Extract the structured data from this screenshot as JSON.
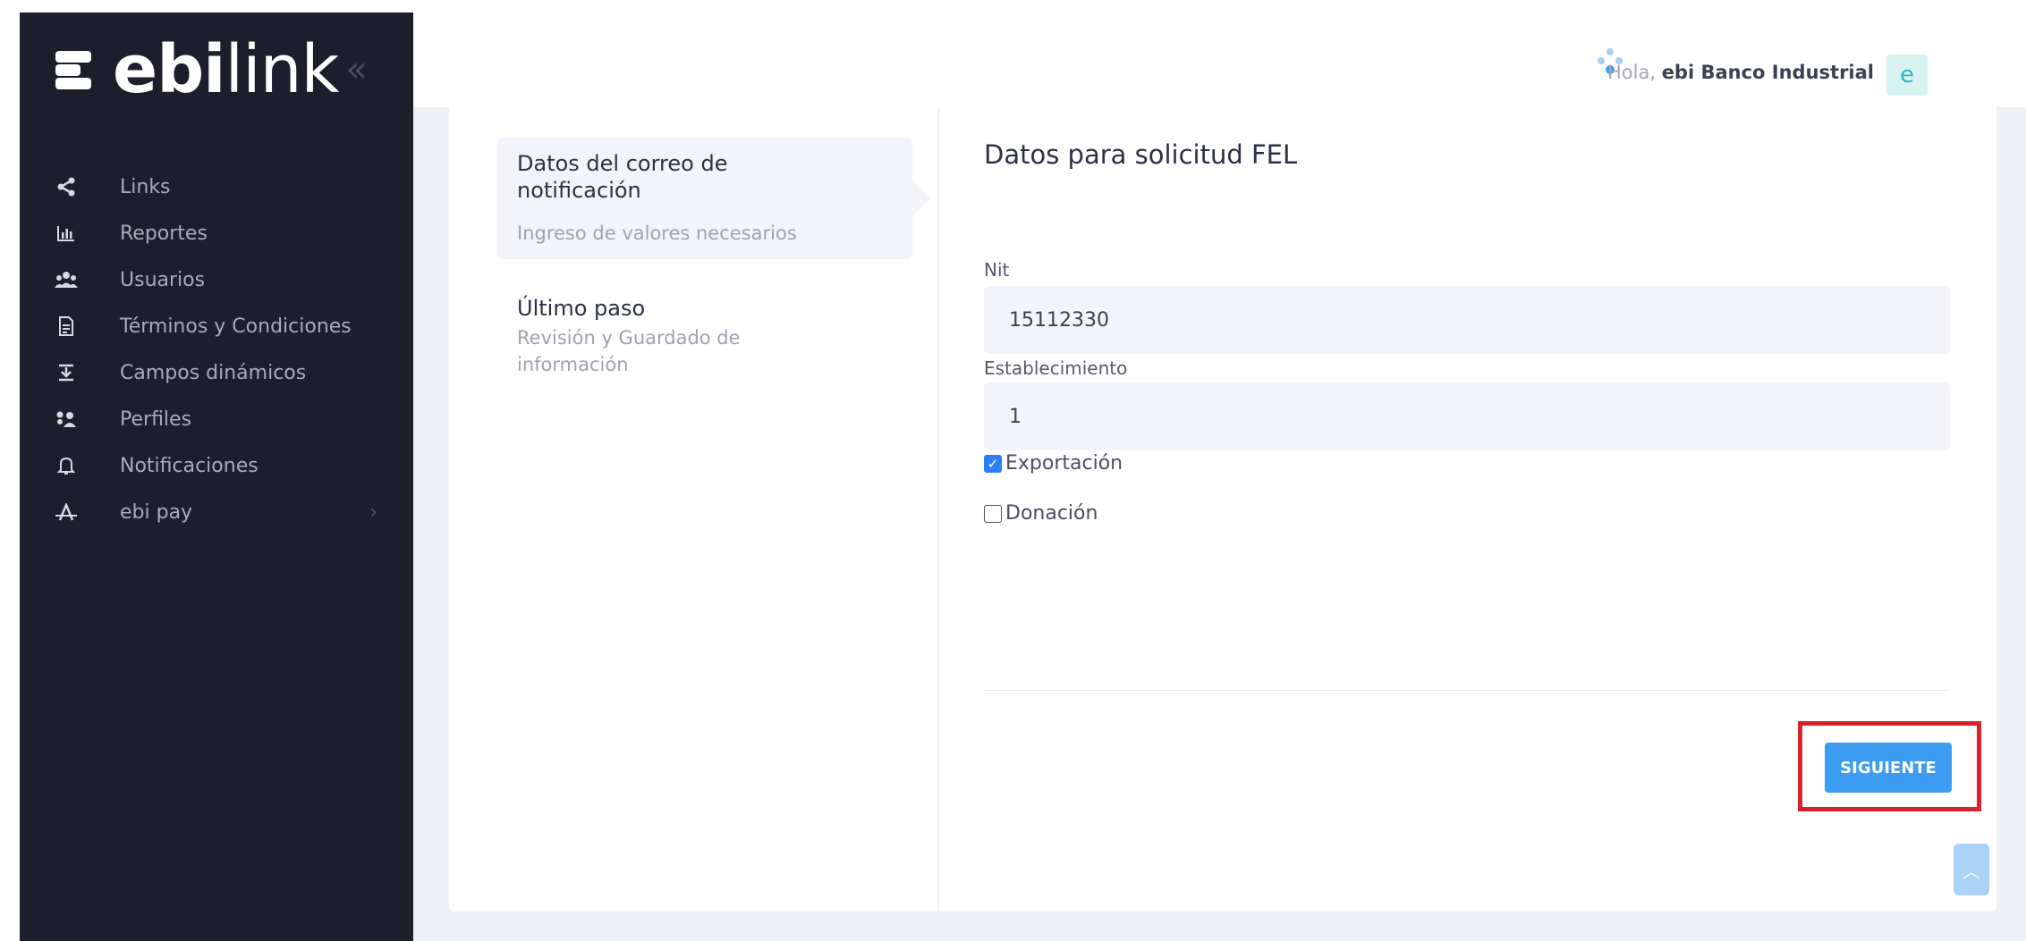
{
  "brand": {
    "logo_bold": "ebi",
    "logo_light": "link",
    "collapse": "«"
  },
  "header": {
    "greeting_prefix": "Hola, ",
    "user_name": "ebi Banco Industrial",
    "avatar_letter": "e"
  },
  "sidebar": {
    "items": [
      {
        "label": "Links",
        "icon": "share-icon"
      },
      {
        "label": "Reportes",
        "icon": "bar-chart-icon"
      },
      {
        "label": "Usuarios",
        "icon": "users-icon"
      },
      {
        "label": "Términos y Condiciones",
        "icon": "document-icon"
      },
      {
        "label": "Campos dinámicos",
        "icon": "form-fields-icon"
      },
      {
        "label": "Perfiles",
        "icon": "profiles-icon"
      },
      {
        "label": "Notificaciones",
        "icon": "bell-icon"
      },
      {
        "label": "ebi pay",
        "icon": "ebi-pay-icon",
        "chevron": "›"
      }
    ]
  },
  "steps": [
    {
      "title": "Datos del correo de notificación",
      "subtitle": "Ingreso de valores necesarios",
      "active": true
    },
    {
      "title": "Último paso",
      "subtitle": "Revisión y Guardado de información",
      "active": false
    }
  ],
  "form": {
    "title": "Datos para solicitud FEL",
    "nit_label": "Nit",
    "nit_value": "15112330",
    "establecimiento_label": "Establecimiento",
    "establecimiento_value": "1",
    "exportacion_label": "Exportación",
    "exportacion_checked": true,
    "donacion_label": "Donación",
    "donacion_checked": false,
    "next_label": "SIGUIENTE"
  },
  "colors": {
    "sidebar_bg": "#1c1e2b",
    "primary": "#3b9cf2",
    "highlight": "#d9232b",
    "accent_teal": "#31b7c0"
  }
}
